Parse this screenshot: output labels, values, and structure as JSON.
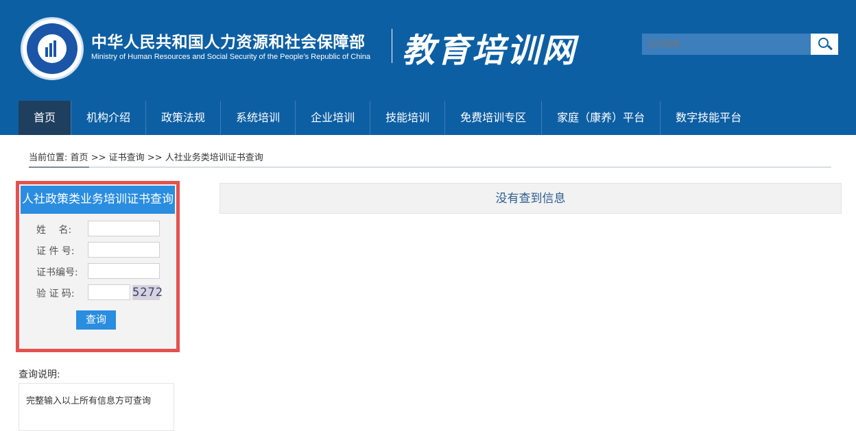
{
  "header": {
    "ministry_cn": "中华人民共和国人力资源和社会保障部",
    "ministry_en": "Ministry of Human Resources and Social Security of the People’s Republic of China",
    "site_title": "教育培训网",
    "search_placeholder": "站内搜索"
  },
  "nav": {
    "items": [
      {
        "label": "首页"
      },
      {
        "label": "机构介绍"
      },
      {
        "label": "政策法规"
      },
      {
        "label": "系统培训"
      },
      {
        "label": "企业培训"
      },
      {
        "label": "技能培训"
      },
      {
        "label": "免费培训专区"
      },
      {
        "label": "家庭（康养）平台"
      },
      {
        "label": "数字技能平台"
      }
    ],
    "active_index": 0
  },
  "breadcrumb": {
    "prefix": "当前位置:",
    "items": [
      "首页",
      "证书查询",
      "人社业务类培训证书查询"
    ],
    "separator": ">>"
  },
  "query_panel": {
    "title": "人社政策类业务培训证书查询",
    "fields": [
      {
        "label": "姓　 名:",
        "value": ""
      },
      {
        "label": "证 件 号:",
        "value": ""
      },
      {
        "label": "证书编号:",
        "value": ""
      },
      {
        "label": "验 证 码:",
        "value": ""
      }
    ],
    "captcha_text": "5272",
    "submit_label": "查询"
  },
  "instructions": {
    "title": "查询说明:",
    "text": "完整输入以上所有信息方可查询"
  },
  "result": {
    "message": "没有查到信息"
  },
  "colors": {
    "header_bg": "#0d5fa3",
    "nav_active_bg": "#1f3f5e",
    "panel_border": "#e4524f",
    "accent_blue": "#2a8de0"
  }
}
